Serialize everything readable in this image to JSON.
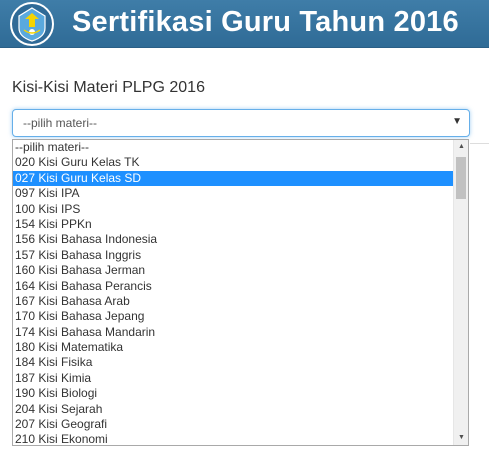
{
  "header": {
    "title": "Sertifikasi Guru Tahun 2016",
    "logo_icon": "tut-wuri-handayani-emblem-icon",
    "background": "#3a77a3"
  },
  "form": {
    "label": "Kisi-Kisi Materi PLPG 2016",
    "select": {
      "value": "--pilih materi--",
      "caret_icon": "caret-down-icon",
      "caret": "▼"
    }
  },
  "dropdown": {
    "selected_color": "#1e90ff",
    "options": [
      {
        "label": "--pilih materi--"
      },
      {
        "label": "020 Kisi Guru Kelas TK"
      },
      {
        "label": "027 Kisi Guru Kelas SD",
        "highlighted": true
      },
      {
        "label": "097 Kisi IPA"
      },
      {
        "label": "100 Kisi IPS"
      },
      {
        "label": "154 Kisi PPKn"
      },
      {
        "label": "156 Kisi Bahasa Indonesia"
      },
      {
        "label": "157 Kisi Bahasa Inggris"
      },
      {
        "label": "160 Kisi Bahasa Jerman"
      },
      {
        "label": "164 Kisi Bahasa Perancis"
      },
      {
        "label": "167 Kisi Bahasa Arab"
      },
      {
        "label": "170 Kisi Bahasa Jepang"
      },
      {
        "label": "174 Kisi Bahasa Mandarin"
      },
      {
        "label": "180 Kisi Matematika"
      },
      {
        "label": "184 Kisi Fisika"
      },
      {
        "label": "187 Kisi Kimia"
      },
      {
        "label": "190 Kisi Biologi"
      },
      {
        "label": "204 Kisi Sejarah"
      },
      {
        "label": "207 Kisi Geografi"
      },
      {
        "label": "210 Kisi Ekonomi"
      }
    ],
    "scrollbar": {
      "up_icon": "scroll-up-arrow-icon",
      "down_icon": "scroll-down-arrow-icon",
      "up": "▲",
      "down": "▼"
    }
  }
}
